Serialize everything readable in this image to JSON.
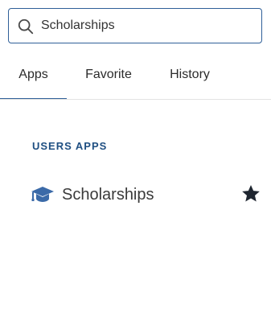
{
  "search": {
    "value": "Scholarships",
    "icon": "search-icon"
  },
  "tabs": [
    {
      "label": "Apps",
      "active": true
    },
    {
      "label": "Favorite",
      "active": false
    },
    {
      "label": "History",
      "active": false
    }
  ],
  "section": {
    "title": "USERS APPS",
    "apps": [
      {
        "label": "Scholarships",
        "icon": "graduation-cap-icon",
        "favorite": true
      }
    ]
  },
  "colors": {
    "accent": "#2f5f98",
    "section_title": "#1f4f82",
    "app_icon": "#3b6aa8",
    "star": "#1f2630"
  }
}
